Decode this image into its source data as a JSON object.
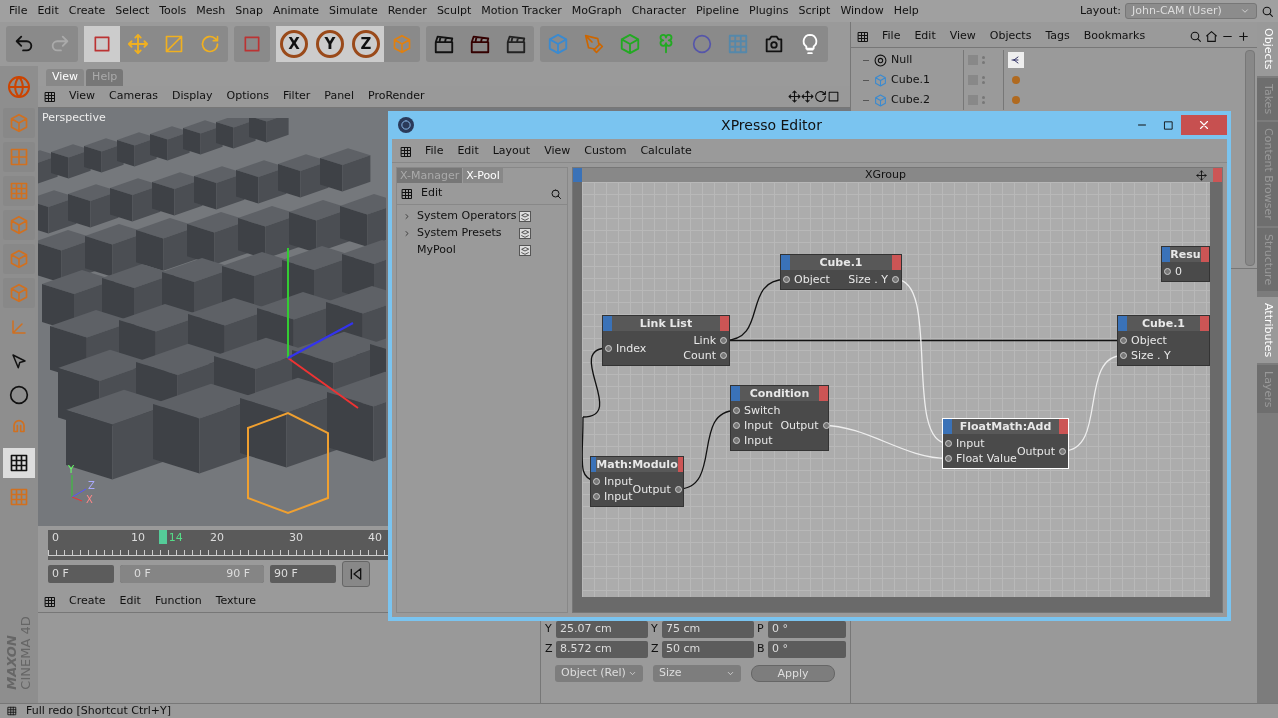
{
  "menu_bar": {
    "items": [
      "File",
      "Edit",
      "Create",
      "Select",
      "Tools",
      "Mesh",
      "Snap",
      "Animate",
      "Simulate",
      "Render",
      "Sculpt",
      "Motion Tracker",
      "MoGraph",
      "Character",
      "Pipeline",
      "Plugins",
      "Script",
      "Window",
      "Help"
    ],
    "layout_label": "Layout:",
    "layout_value": "John-CAM (User)"
  },
  "toolbar": {
    "axis_buttons": [
      "X",
      "Y",
      "Z"
    ]
  },
  "viewport": {
    "tabs": [
      {
        "label": "View",
        "selected": true
      },
      {
        "label": "Help",
        "selected": false
      }
    ],
    "menu": [
      "View",
      "Cameras",
      "Display",
      "Options",
      "Filter",
      "Panel",
      "ProRender"
    ],
    "camera": "Perspective",
    "axis_labels": [
      "Y",
      "Z",
      "X"
    ]
  },
  "timeline": {
    "ticks": [
      "0",
      "10",
      "20",
      "30",
      "40"
    ],
    "current_frame": "14",
    "level": 0.145
  },
  "frame_controls": {
    "start": "0 F",
    "range_start": "0 F",
    "range_end": "90 F",
    "end": "90 F",
    "level": 1
  },
  "material_manager": {
    "menu": [
      "Create",
      "Edit",
      "Function",
      "Texture"
    ]
  },
  "brand": {
    "line1": "MAXON",
    "line2": "CINEMA 4D"
  },
  "coordinates": {
    "rows": [
      {
        "axis": "Y",
        "position": "25.07 cm",
        "size_axis": "Y",
        "size": "75 cm",
        "rot_axis": "P",
        "rotation": "0 °"
      },
      {
        "axis": "Z",
        "position": "8.572 cm",
        "size_axis": "Z",
        "size": "50 cm",
        "rot_axis": "B",
        "rotation": "0 °"
      }
    ],
    "mode": "Object (Rel)",
    "size_mode": "Size",
    "apply": "Apply"
  },
  "object_manager": {
    "menu": [
      "File",
      "Edit",
      "View",
      "Objects",
      "Tags",
      "Bookmarks"
    ],
    "objects": [
      {
        "name": "Null",
        "kind": "null"
      },
      {
        "name": "Cube.1",
        "kind": "cube"
      },
      {
        "name": "Cube.2",
        "kind": "cube"
      }
    ]
  },
  "side_tabs_top": [
    {
      "label": "Objects",
      "selected": true
    },
    {
      "label": "Takes",
      "selected": false
    },
    {
      "label": "Content Browser",
      "selected": false
    },
    {
      "label": "Structure",
      "selected": false
    }
  ],
  "side_tabs_bottom": [
    {
      "label": "Attributes",
      "selected": true
    },
    {
      "label": "Layers",
      "selected": false
    }
  ],
  "xpresso": {
    "title": "XPresso Editor",
    "menu": [
      "File",
      "Edit",
      "Layout",
      "View",
      "Custom",
      "Calculate"
    ],
    "pool_tabs": [
      {
        "label": "X-Manager",
        "selected": false
      },
      {
        "label": "X-Pool",
        "selected": true
      }
    ],
    "pool_menu": "Edit",
    "pool_items": [
      {
        "label": "System Operators",
        "expandable": true
      },
      {
        "label": "System Presets",
        "expandable": true
      },
      {
        "label": "MyPool",
        "expandable": false
      }
    ],
    "group_title": "XGroup",
    "nodes": [
      {
        "title": "Cube.1",
        "inputs": [
          "Object"
        ],
        "outputs": [
          "Size . Y"
        ],
        "selected": false
      },
      {
        "title": "Resu",
        "inputs": [
          "0"
        ],
        "selected": false
      },
      {
        "title": "Link List",
        "inputs": [
          "Index"
        ],
        "outputs": [
          "Link",
          "Count"
        ],
        "selected": false
      },
      {
        "title": "Cube.1",
        "inputs": [
          "Object",
          "Size . Y"
        ],
        "selected": false
      },
      {
        "title": "Condition",
        "inputs": [
          "Switch",
          "Input",
          "Input"
        ],
        "outputs": [
          "Output"
        ],
        "selected": false
      },
      {
        "title": "FloatMath:Add",
        "inputs": [
          "Input",
          "Float Value"
        ],
        "outputs": [
          "Output"
        ],
        "selected": true
      },
      {
        "title": "Math:Modulo",
        "inputs": [
          "Input",
          "Input"
        ],
        "outputs": [
          "Output"
        ],
        "selected": false
      }
    ]
  },
  "status_bar": "Full redo [Shortcut Ctrl+Y]"
}
